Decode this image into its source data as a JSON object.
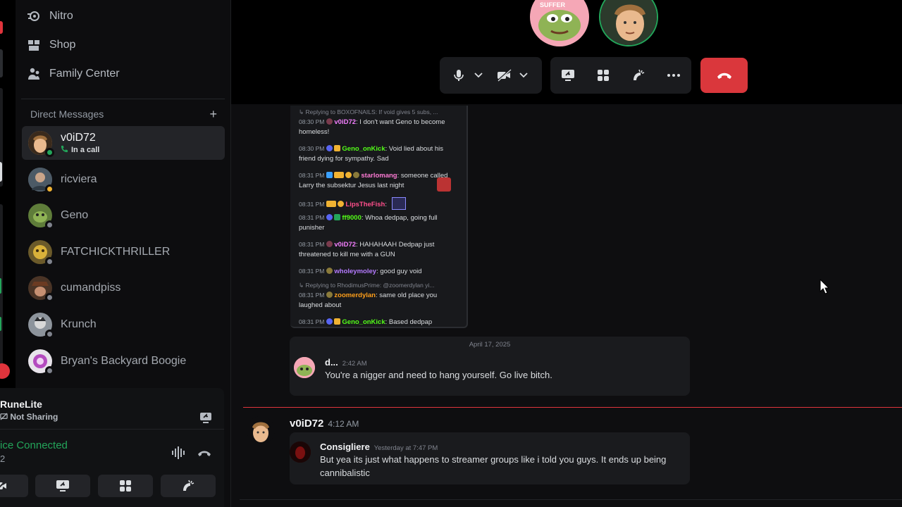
{
  "sidebar": {
    "nav": [
      {
        "label": "Nitro",
        "icon": "nitro-icon"
      },
      {
        "label": "Shop",
        "icon": "shop-icon"
      },
      {
        "label": "Family Center",
        "icon": "family-center-icon"
      }
    ],
    "dm_header": "Direct Messages",
    "dm_add": "+",
    "dms": [
      {
        "name": "v0iD72",
        "status": "In a call"
      },
      {
        "name": "ricviera"
      },
      {
        "name": "Geno"
      },
      {
        "name": "FATCHICKTHRILLER"
      },
      {
        "name": "cumandpiss"
      },
      {
        "name": "Krunch"
      },
      {
        "name": "Bryan's Backyard Boogie"
      }
    ]
  },
  "panel": {
    "stream_title": "RuneLite",
    "stream_status": "Not Sharing",
    "voice_status": "ice Connected",
    "voice_sub": "2"
  },
  "stage": {
    "pfp_label": "SUFFER"
  },
  "chat_image": {
    "lines": [
      {
        "reply": "Replying to BOXOFNAILS: If void gives 5 subs, ..."
      },
      {
        "time": "08:30 PM",
        "user": "v0iD72",
        "color": "#f47fff",
        "text": ": I don't want Geno to become homeless!"
      },
      {
        "time": "08:30 PM",
        "user": "Geno_onKick",
        "color": "#53fc18",
        "text": ": Void lied about his friend dying for sympathy. Sad"
      },
      {
        "time": "08:31 PM",
        "user": "starlomang",
        "color": "#ff7bd5",
        "text": ": someone called Larry the subsektur Jesus last night"
      },
      {
        "time": "08:31 PM",
        "user": "LipsTheFish",
        "color": "#ff4f8b",
        "text": ":"
      },
      {
        "time": "08:31 PM",
        "user": "ff9000",
        "color": "#53fc18",
        "text": ": Whoa dedpap, going full punisher"
      },
      {
        "time": "08:31 PM",
        "user": "v0iD72",
        "color": "#f47fff",
        "text": ": HAHAHAAH Dedpap just threatened to kill me with a GUN"
      },
      {
        "time": "08:31 PM",
        "user": "wholeymoley",
        "color": "#b57bff",
        "text": ": good guy void"
      },
      {
        "reply": "Replying to RhodimusPrime: @zoomerdylan yi..."
      },
      {
        "time": "08:31 PM",
        "user": "zoomerdylan",
        "color": "#ff9f1a",
        "text": ": same old place you laughed about"
      },
      {
        "time": "08:31 PM",
        "user": "Geno_onKick",
        "color": "#53fc18",
        "text": ": Based dedpap"
      }
    ]
  },
  "embed1": {
    "date": "April 17, 2025",
    "user": "d...",
    "time": "2:42 AM",
    "text": "You're a nigger and need to hang yourself. Go live bitch."
  },
  "message": {
    "user": "v0iD72",
    "time": "4:12 AM"
  },
  "embed2": {
    "user": "Consigliere",
    "time": "Yesterday at 7:47 PM",
    "text": "But yea its just what happens to streamer groups like i told you guys. It ends up being cannibalistic"
  },
  "colors": {
    "accent_green": "#23a55a",
    "danger_red": "#da373c"
  }
}
